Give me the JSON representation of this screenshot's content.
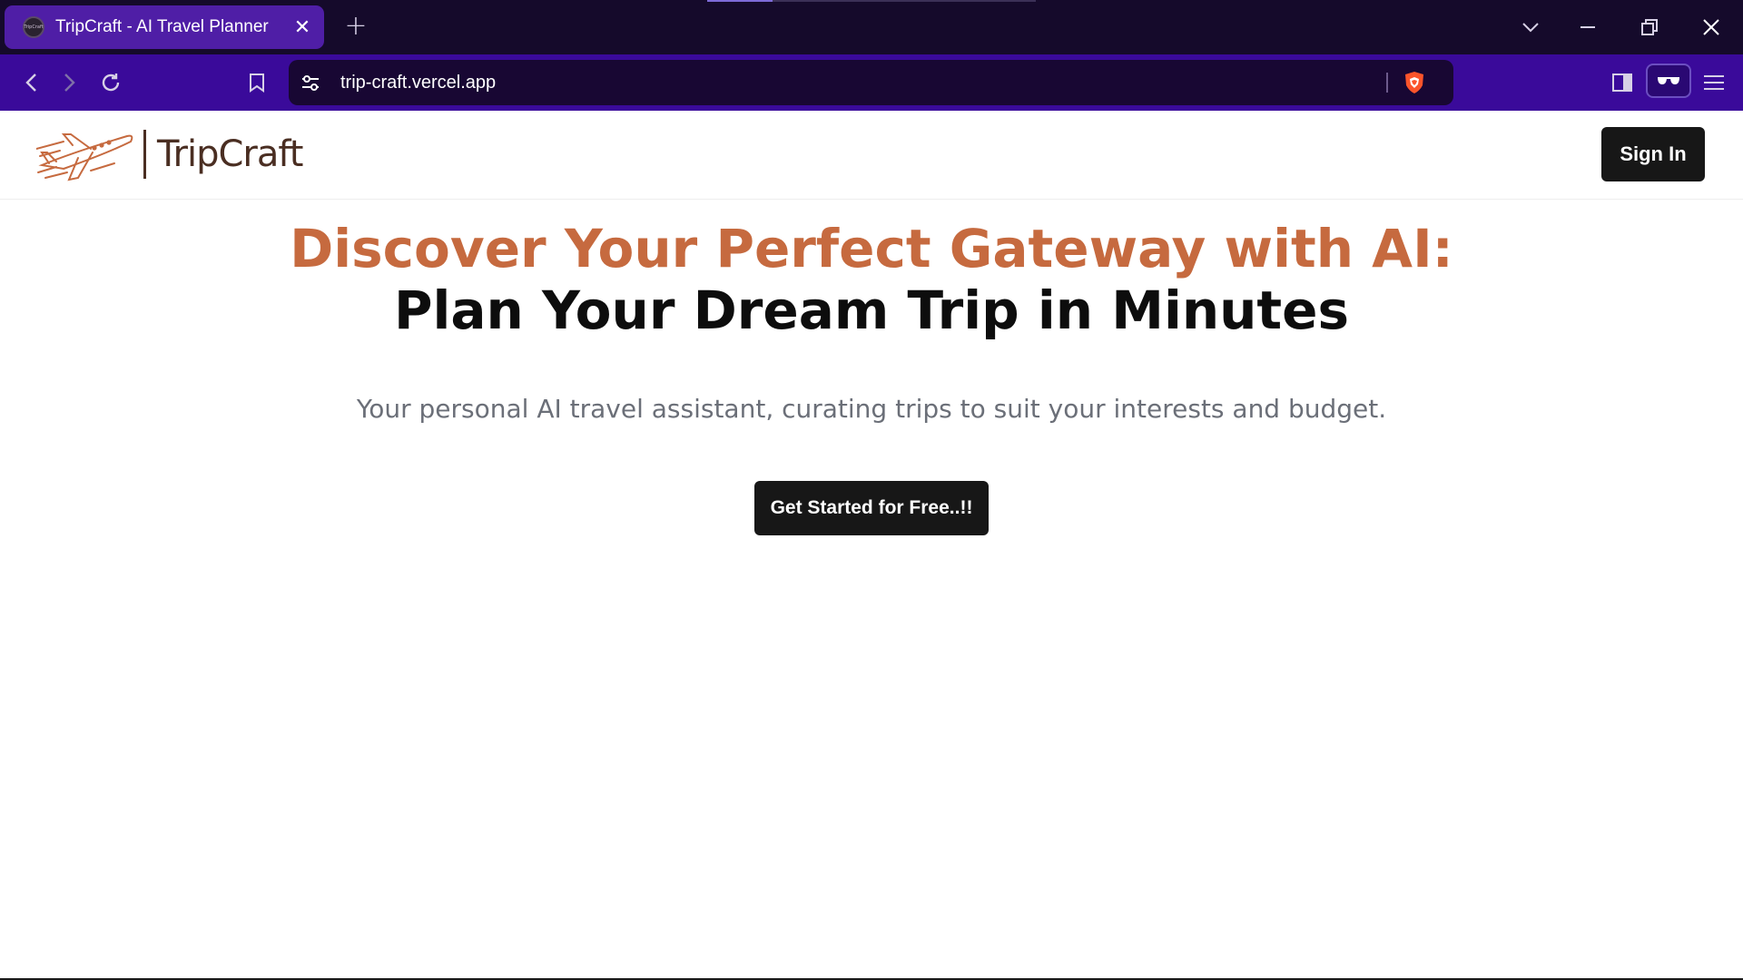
{
  "browser": {
    "tab": {
      "title": "TripCraft - AI Travel Planner",
      "favicon_text": "TripCraft",
      "close_glyph": "✕"
    },
    "new_tab_glyph": "+",
    "url": "trip-craft.vercel.app",
    "icons": [
      "tab-search-icon",
      "minimize-icon",
      "restore-icon",
      "close-icon",
      "back-icon",
      "forward-icon",
      "reload-icon",
      "bookmark-icon",
      "site-settings-icon",
      "brave-shield-icon",
      "sidebar-icon",
      "wallet-icon",
      "menu-icon"
    ],
    "colors": {
      "tabstrip": "#150a2b",
      "toolbar": "#3a0a9a",
      "active_tab": "#4f1ea6",
      "urlbar": "#180733"
    }
  },
  "site": {
    "logo_text": "TripCraft",
    "signin_label": "Sign In",
    "hero": {
      "line1": "Discover Your Perfect Gateway with AI:",
      "line2": "Plan Your Dream Trip in Minutes",
      "subtitle": "Your personal AI travel assistant, curating trips to suit your interests and budget.",
      "cta_label": "Get Started for Free..!!"
    },
    "colors": {
      "accent": "#c66a3f",
      "button": "#171717",
      "subtitle": "#6b6f78"
    }
  }
}
